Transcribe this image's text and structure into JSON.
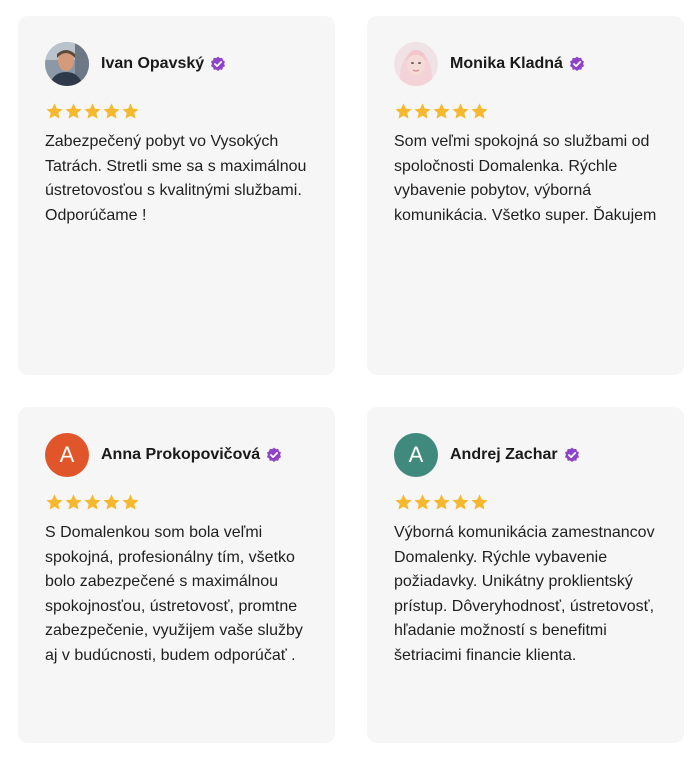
{
  "colors": {
    "card_bg": "#f6f6f6",
    "star": "#f5b82e",
    "verified": "#8e44c8",
    "avatar_orange": "#e1552b",
    "avatar_teal": "#3f8a7c"
  },
  "reviews": [
    {
      "name": "Ivan Opavský",
      "avatar_type": "photo",
      "verified_icon": "verified-badge-icon",
      "rating": 5,
      "text": "Zabezpečený pobyt vo Vysokých Tatrách. Stretli sme sa s maximálnou ústretovosťou s kvalitnými službami. Odporúčame !"
    },
    {
      "name": "Monika Kladná",
      "avatar_type": "photo",
      "verified_icon": "verified-badge-icon",
      "rating": 5,
      "text": "Som veľmi spokojná so službami od spoločnosti Domalenka. Rýchle vybavenie pobytov, výborná komunikácia. Všetko super. Ďakujem"
    },
    {
      "name": "Anna Prokopovičová",
      "avatar_type": "initial",
      "avatar_initial": "A",
      "avatar_color": "#e1552b",
      "verified_icon": "verified-badge-icon",
      "rating": 5,
      "text": "S Domalenkou som bola veľmi spokojná, profesionálny tím, všetko bolo zabezpečené s maximálnou spokojnosťou, ústretovosť, promtne zabezpečenie, využijem vaše služby aj v budúcnosti, budem odporúčať ."
    },
    {
      "name": "Andrej Zachar",
      "avatar_type": "initial",
      "avatar_initial": "A",
      "avatar_color": "#3f8a7c",
      "verified_icon": "verified-badge-icon",
      "rating": 5,
      "text": "Výborná komunikácia zamestnancov Domalenky. Rýchle vybavenie požiadavky. Unikátny proklientský prístup. Dôveryhodnosť, ústretovosť, hľadanie možností s benefitmi šetriacimi financie klienta."
    }
  ]
}
